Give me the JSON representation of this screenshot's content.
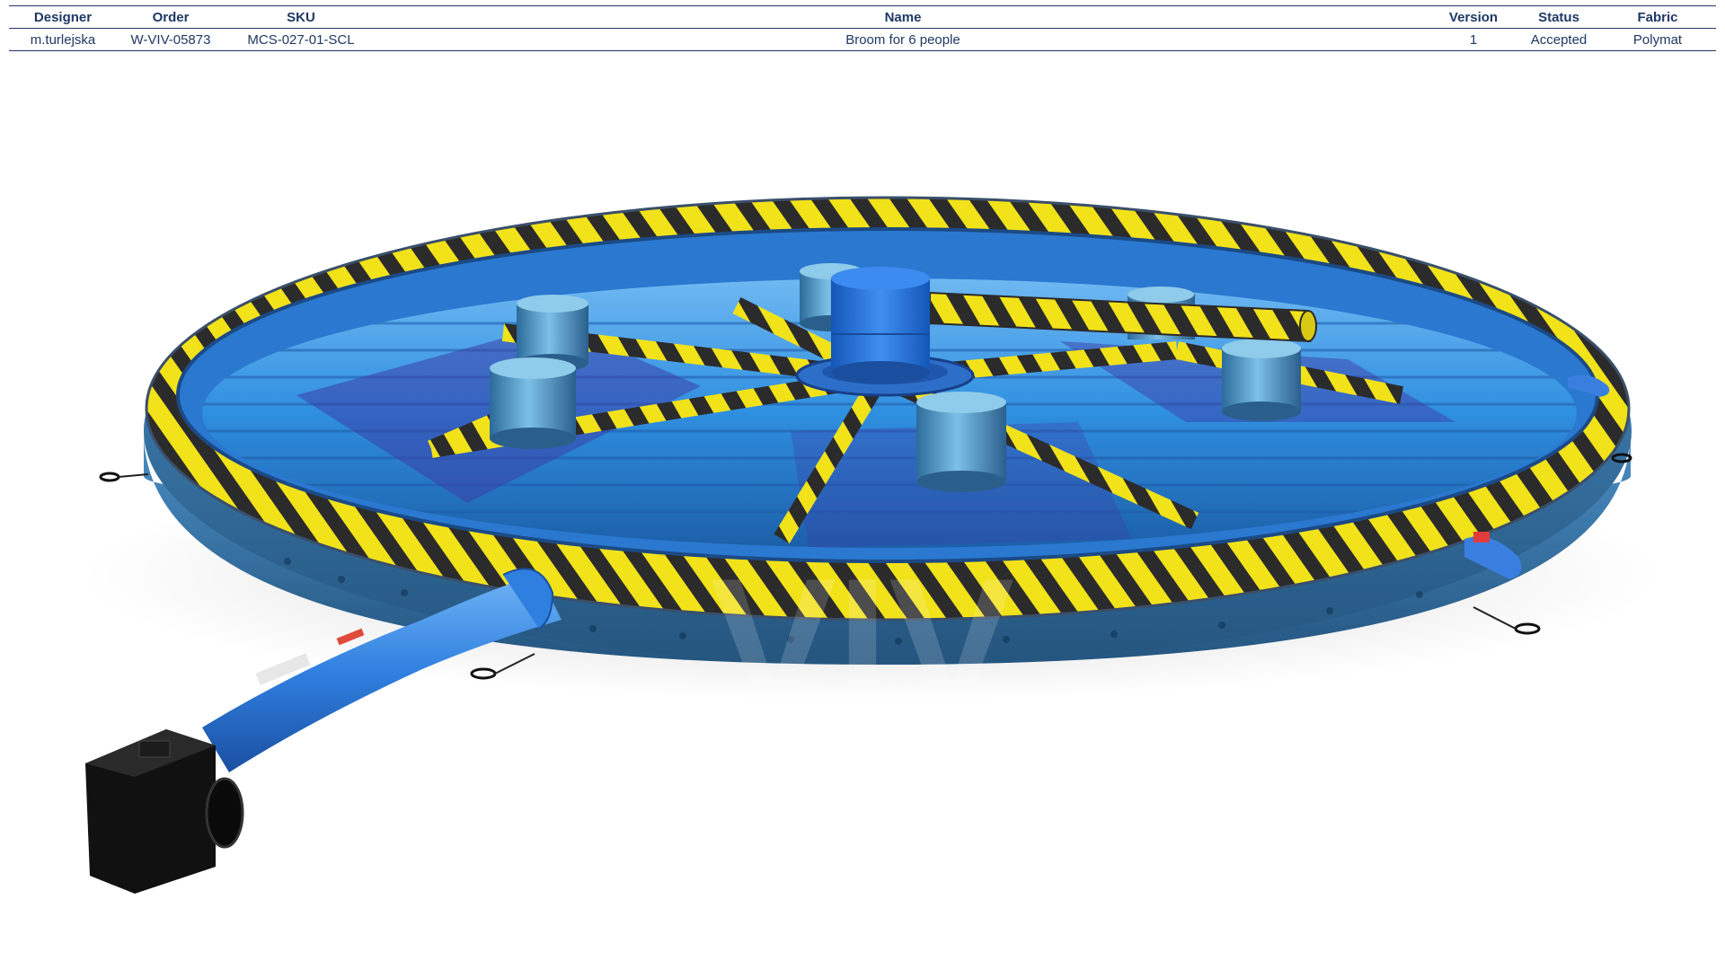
{
  "table": {
    "headers": {
      "designer": "Designer",
      "order": "Order",
      "sku": "SKU",
      "name": "Name",
      "version": "Version",
      "status": "Status",
      "fabric": "Fabric"
    },
    "row": {
      "designer": "m.turlejska",
      "order": "W-VIV-05873",
      "sku": "MCS-027-01-SCL",
      "name": "Broom for 6 people",
      "version": "1",
      "status": "Accepted",
      "fabric": "Polymat"
    }
  },
  "product_image": {
    "subject": "inflatable circular broom arena with six pillars, rotating central hub with striped arm, and blower",
    "watermark_text": "VIV",
    "colors": {
      "base_blue": "#2f8fe0",
      "dark_blue": "#1c5fa8",
      "navy": "#2a3f8a",
      "hazard_yellow": "#f2e21a",
      "hazard_dark": "#2b2b2b",
      "blower_black": "#111111"
    }
  }
}
